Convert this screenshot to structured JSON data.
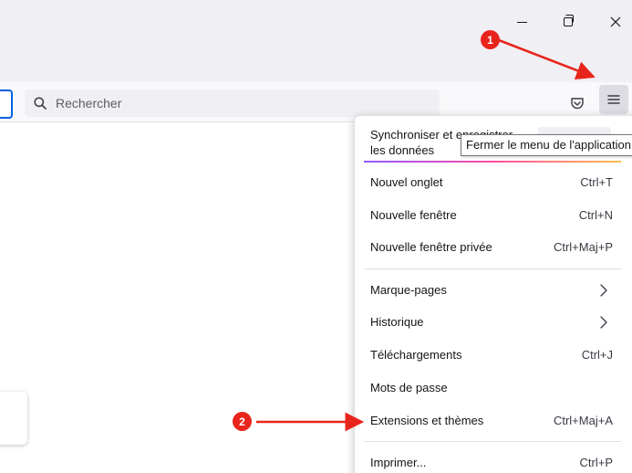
{
  "window_controls": {
    "minimize_icon": "minimize-icon",
    "restore_icon": "restore-icon",
    "close_icon": "close-icon"
  },
  "toolbar": {
    "search_placeholder": "Rechercher",
    "pocket_icon": "pocket-icon",
    "menu_icon": "hamburger-menu-icon"
  },
  "tooltip": {
    "text": "Fermer le menu de l'application"
  },
  "app_menu": {
    "sync": {
      "line1": "Synchroniser et enregistrer",
      "line2": "les données"
    },
    "items": [
      {
        "label": "Nouvel onglet",
        "shortcut": "Ctrl+T"
      },
      {
        "label": "Nouvelle fenêtre",
        "shortcut": "Ctrl+N"
      },
      {
        "label": "Nouvelle fenêtre privée",
        "shortcut": "Ctrl+Maj+P"
      },
      {
        "label": "Marque-pages",
        "shortcut": ""
      },
      {
        "label": "Historique",
        "shortcut": ""
      },
      {
        "label": "Téléchargements",
        "shortcut": "Ctrl+J"
      },
      {
        "label": "Mots de passe",
        "shortcut": ""
      },
      {
        "label": "Extensions et thèmes",
        "shortcut": "Ctrl+Maj+A"
      },
      {
        "label": "Imprimer...",
        "shortcut": "Ctrl+P"
      }
    ]
  },
  "annotations": {
    "step1": "1",
    "step2": "2",
    "color": "#e8251d"
  },
  "colors": {
    "accent": "#0061e0",
    "menu_button_active": "#dcdce2"
  }
}
